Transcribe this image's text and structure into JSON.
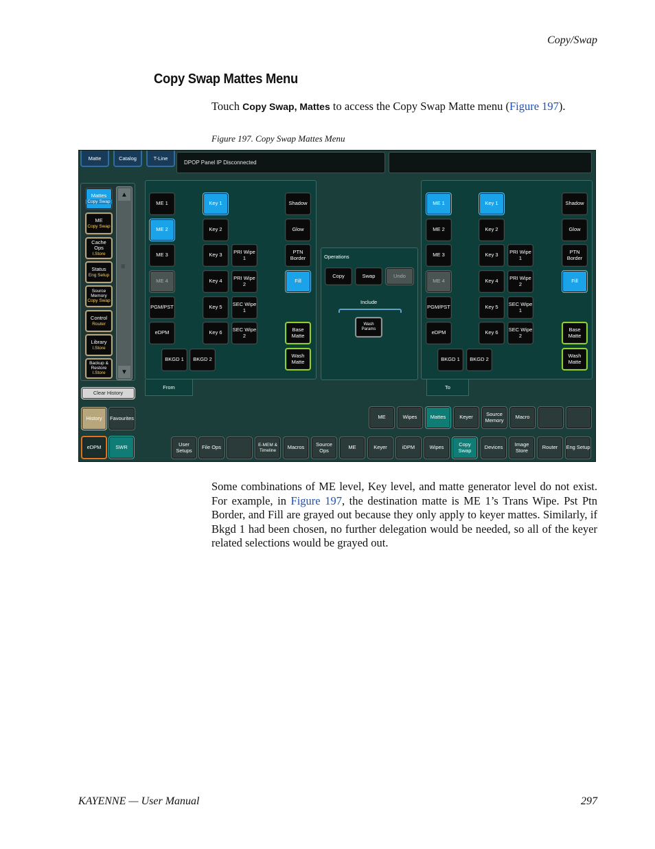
{
  "page": {
    "running_head": "Copy/Swap",
    "section_title": "Copy Swap Mattes Menu",
    "intro": {
      "pre": "Touch ",
      "ui1": "Copy Swap",
      "comma": ", ",
      "ui2": "Mattes",
      "mid": " to access the Copy Swap Matte menu (",
      "link": "Figure 197",
      "post": ")."
    },
    "figure_caption": "Figure 197.  Copy Swap Mattes Menu",
    "paragraph": {
      "pre": "Some combinations of ME level, Key level, and matte generator level do not exist. For example, in ",
      "link": "Figure 197",
      "post": ", the destination matte is ME 1’s Trans Wipe. Pst Ptn Border, and Fill are grayed out because they only apply to keyer mattes. Similarly, if Bkgd 1 had been chosen, no further delegation would be needed, so all of the keyer related selections would be grayed out."
    },
    "footer_left": "KAYENNE  —  User Manual",
    "footer_right": "297"
  },
  "ui": {
    "top_tabs": [
      "Matte",
      "Catalog",
      "T-Line"
    ],
    "status_text": "DPOP Panel IP Disconnected",
    "left_nav": [
      {
        "label": "Mattes",
        "sub": "Copy Swap"
      },
      {
        "label": "ME",
        "sub": "Copy Swap"
      },
      {
        "label": "Cache Ops",
        "sub": "I.Store"
      },
      {
        "label": "Status",
        "sub": "Eng  Setup"
      },
      {
        "label": "Source Memory",
        "sub": "Copy Swap"
      },
      {
        "label": "Control",
        "sub": "Router"
      },
      {
        "label": "Library",
        "sub": "I.Store"
      },
      {
        "label": "Backup & Restore",
        "sub": "I.Store"
      }
    ],
    "clear_history": "Clear History",
    "history": "History",
    "favourites": "Favourites",
    "edpm": "eDPM",
    "swr": "SWR",
    "me_buttons": [
      "ME 1",
      "ME 2",
      "ME 3",
      "ME 4",
      "PGM/PST",
      "eDPM"
    ],
    "key_buttons": [
      "Key 1",
      "Key 2",
      "Key 3",
      "Key 4",
      "Key 5",
      "Key 6"
    ],
    "wipe_buttons": [
      "PRI Wipe 1",
      "PRI Wipe 2",
      "SEC Wipe 1",
      "SEC Wipe 2"
    ],
    "bkgd_buttons": [
      "BKGD 1",
      "BKGD 2"
    ],
    "right_col": [
      "Shadow",
      "Glow",
      "PTN Border",
      "Fill",
      "Base Matte",
      "Wash Matte"
    ],
    "from_label": "From",
    "to_label": "To",
    "operations_label": "Operations",
    "copy": "Copy",
    "swap": "Swap",
    "undo": "Undo",
    "include_label": "Include",
    "wash_params": "Wash Params",
    "sub_menu": [
      "ME",
      "Wipes",
      "Mattes",
      "Keyer",
      "Source Memory",
      "Macro"
    ],
    "bottom_menu": [
      "User Setups",
      "File Ops",
      "",
      "E-MEM & Timeline",
      "Macros",
      "Source Ops",
      "ME",
      "Keyer",
      "iDPM",
      "Wipes",
      "Copy Swap",
      "Devices",
      "Image Store",
      "Router",
      "Eng Setup"
    ]
  }
}
